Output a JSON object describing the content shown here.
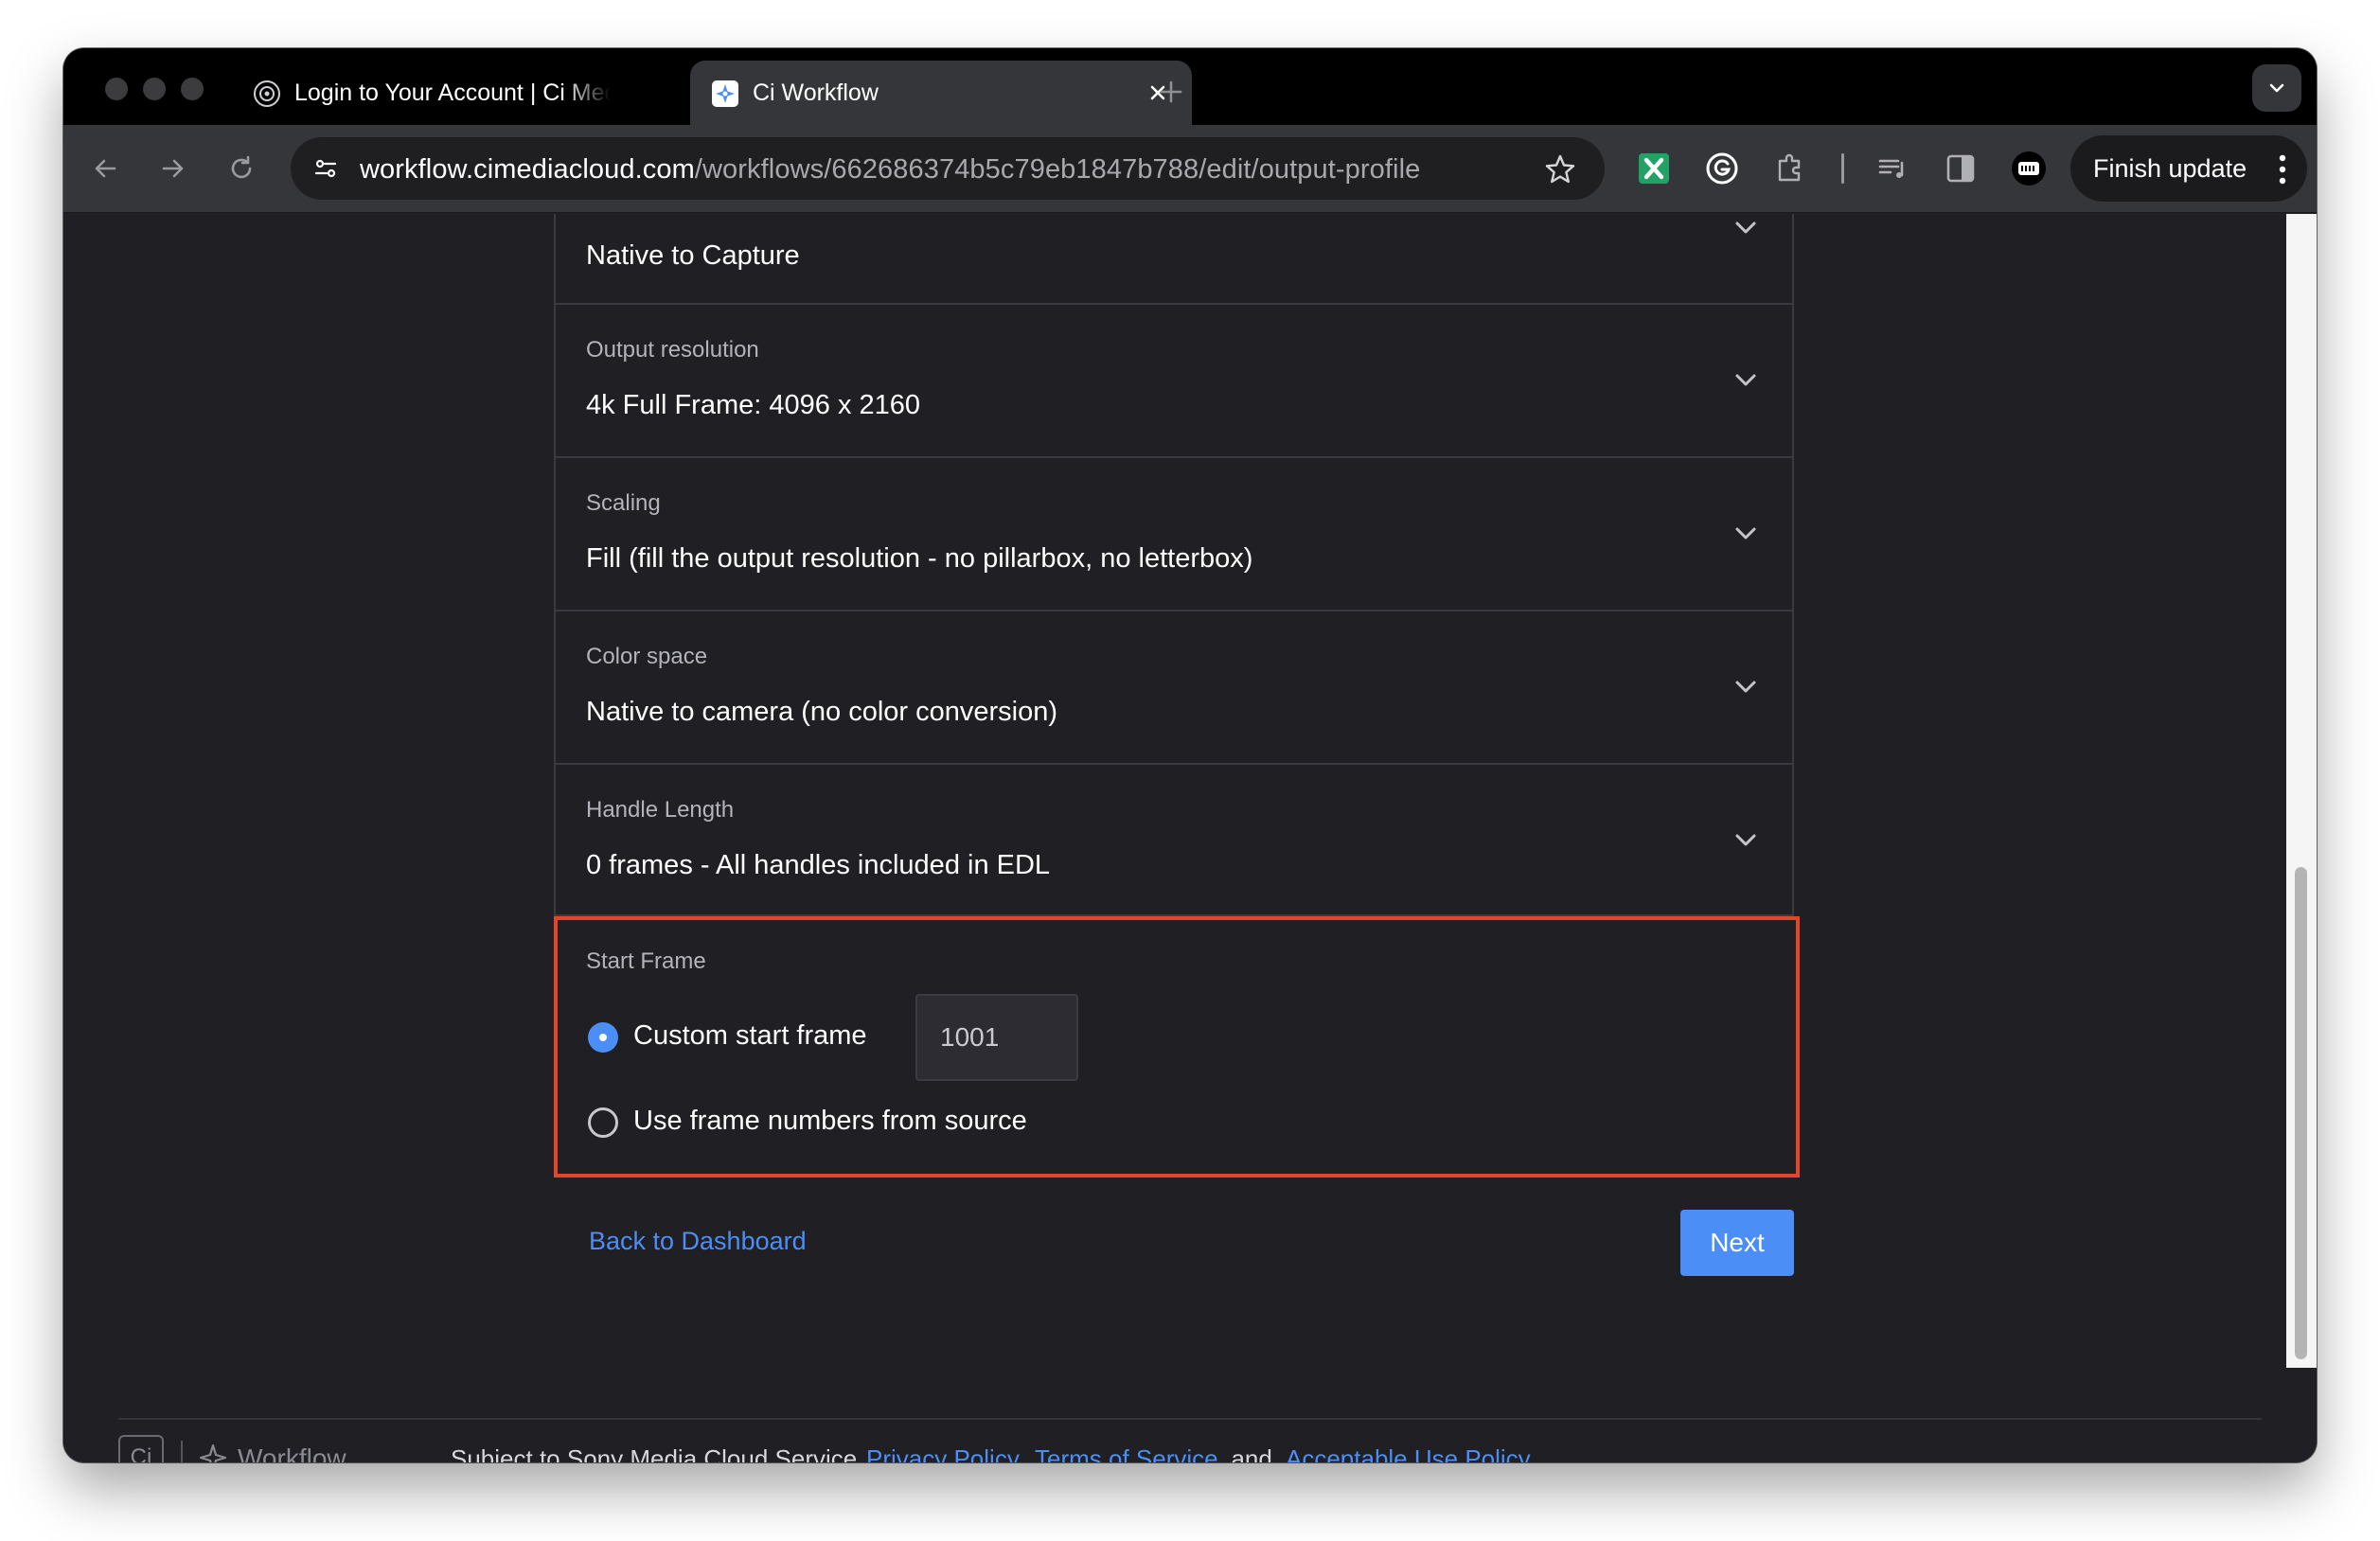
{
  "browser": {
    "tabs": [
      {
        "title": "Login to Your Account | Ci Media Cloud",
        "icon": "ci-favicon",
        "active": false
      },
      {
        "title": "Ci Workflow",
        "icon": "workflow-favicon",
        "active": true
      }
    ],
    "url_domain": "workflow.cimediacloud.com",
    "url_path": "/workflows/662686374b5c79eb1847b788/edit/output-profile",
    "finish_update_label": "Finish update",
    "extension_icons": [
      "excel-icon",
      "grammarly-icon",
      "puzzle-extensions-icon",
      "media-queue-icon",
      "side-panel-icon",
      "obs-icon"
    ]
  },
  "form": {
    "rows": [
      {
        "label": "",
        "value": "Native to Capture"
      },
      {
        "label": "Output resolution",
        "value": "4k Full Frame: 4096 x 2160"
      },
      {
        "label": "Scaling",
        "value": "Fill (fill the output resolution - no pillarbox, no letterbox)"
      },
      {
        "label": "Color space",
        "value": "Native to camera (no color conversion)"
      },
      {
        "label": "Handle Length",
        "value": "0 frames - All handles included in EDL"
      }
    ],
    "start_frame": {
      "label": "Start Frame",
      "option_custom": "Custom start frame",
      "custom_value": "1001",
      "option_source": "Use frame numbers from source",
      "selected": "custom"
    }
  },
  "actions": {
    "back_label": "Back to Dashboard",
    "next_label": "Next"
  },
  "footer": {
    "logo_text": "Ci",
    "product": "Workflow",
    "prefix": "Subject to Sony Media Cloud Service",
    "privacy": "Privacy Policy",
    "sep1": ",",
    "terms": "Terms of Service",
    "sep2": ", and",
    "aup": "Acceptable Use Policy",
    "end": "."
  },
  "colors": {
    "accent": "#4b8ef5",
    "highlight_border": "#e3452a",
    "page_bg": "#1f1f24"
  }
}
